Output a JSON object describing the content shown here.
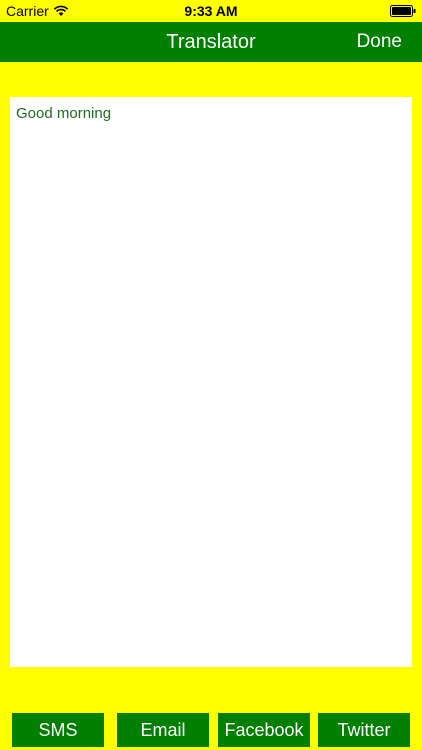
{
  "status_bar": {
    "carrier": "Carrier",
    "time": "9:33 AM"
  },
  "nav": {
    "title": "Translator",
    "done_label": "Done"
  },
  "editor": {
    "text": "Good morning"
  },
  "share": {
    "sms": "SMS",
    "email": "Email",
    "facebook": "Facebook",
    "twitter": "Twitter"
  },
  "colors": {
    "background": "#FFFF00",
    "bar_green": "#007F00",
    "text_green": "#1F6B1F"
  }
}
